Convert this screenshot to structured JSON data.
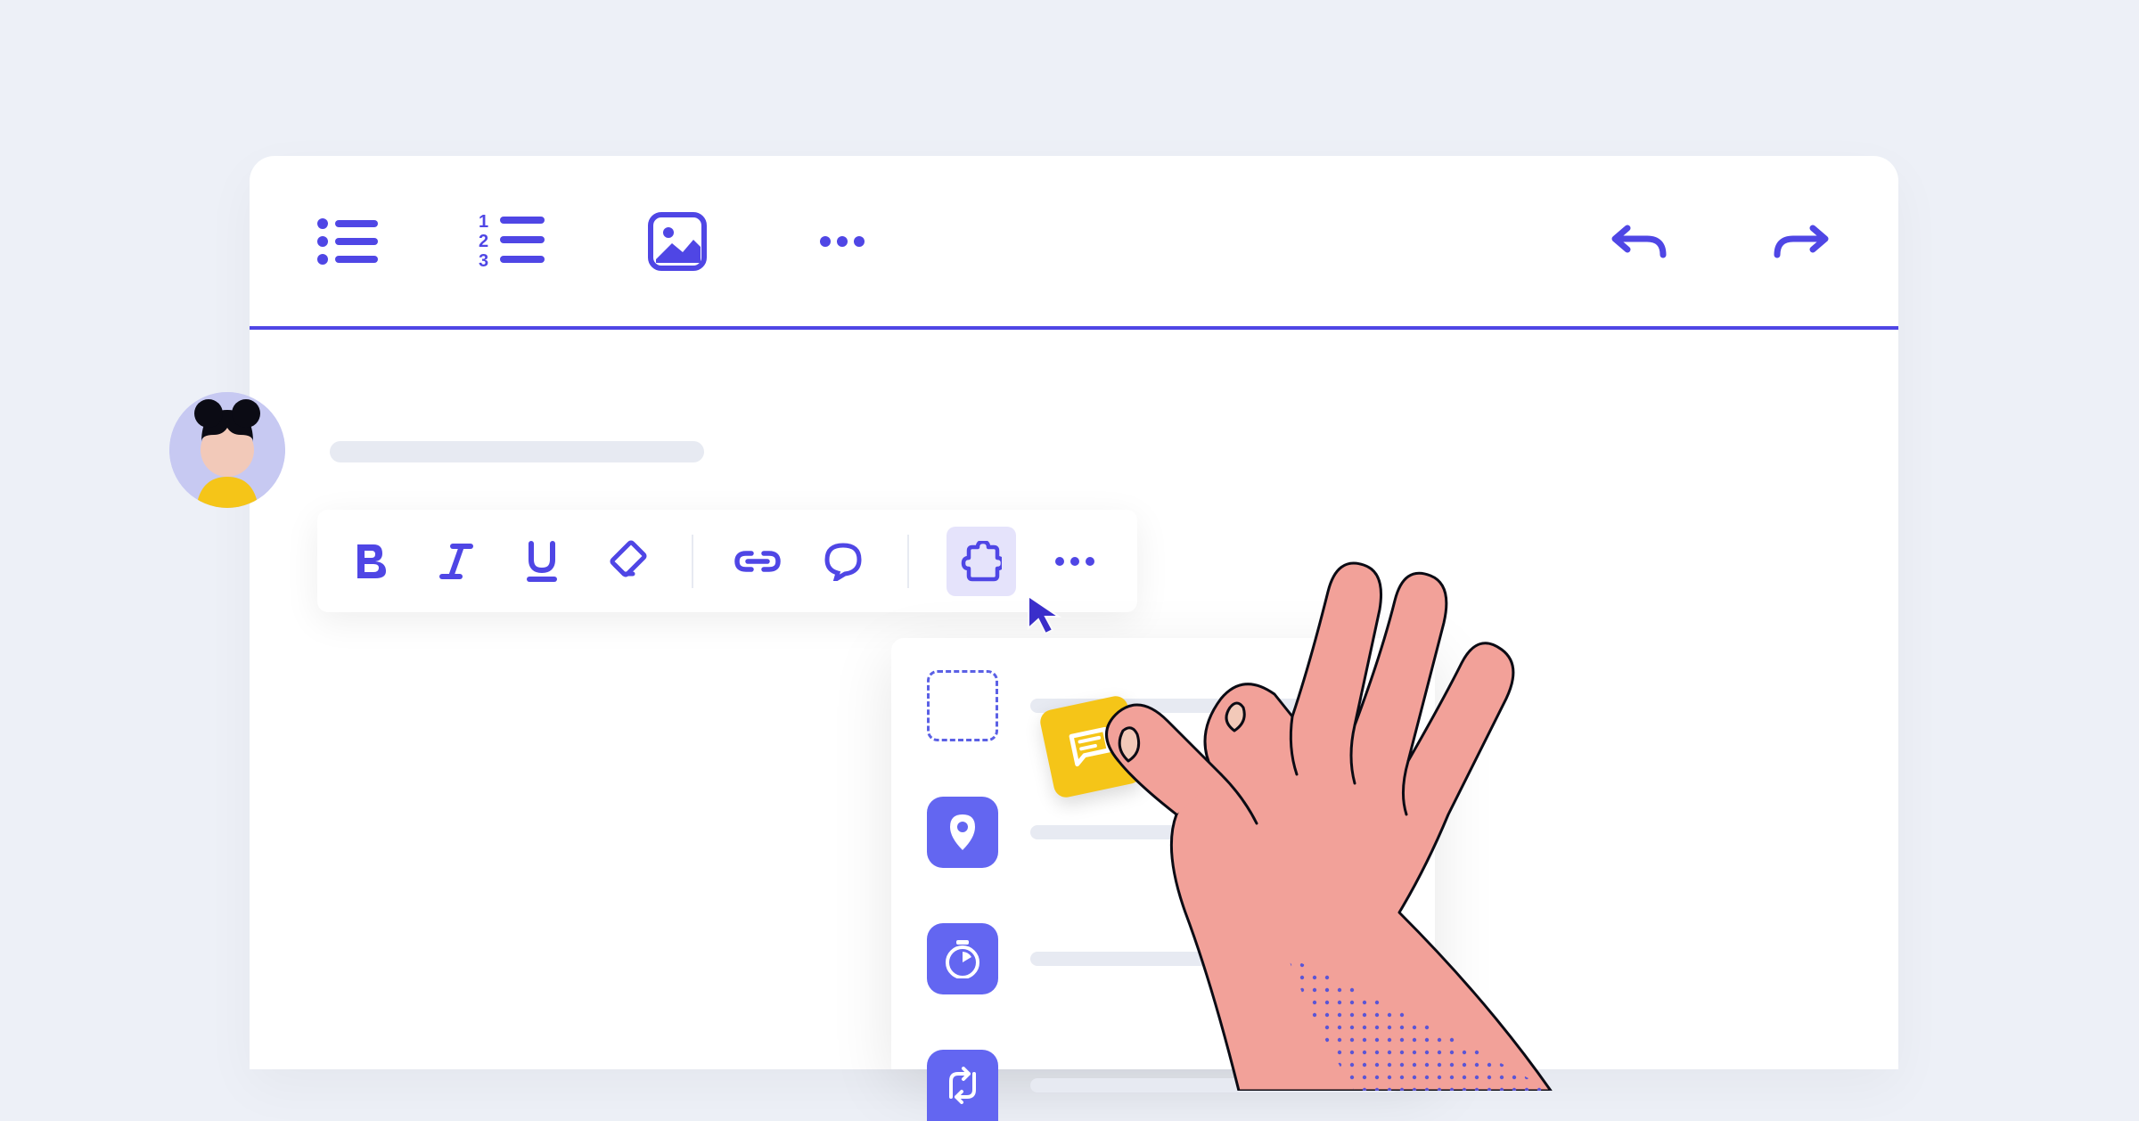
{
  "colors": {
    "accent": "#4F46E5",
    "background": "#EDF0F7",
    "card": "#FFFFFF",
    "placeholder": "#E7EAF2",
    "yellowTile": "#F5C518",
    "hand": "#F2A199"
  },
  "mainToolbar": {
    "left": [
      {
        "name": "bullet-list-icon"
      },
      {
        "name": "numbered-list-icon"
      },
      {
        "name": "image-icon"
      },
      {
        "name": "more-icon"
      }
    ],
    "right": [
      {
        "name": "undo-icon"
      },
      {
        "name": "redo-icon"
      }
    ]
  },
  "floatingToolbar": [
    {
      "name": "bold-icon"
    },
    {
      "name": "italic-icon"
    },
    {
      "name": "underline-icon"
    },
    {
      "name": "clear-format-icon"
    },
    {
      "name": "separator"
    },
    {
      "name": "link-icon"
    },
    {
      "name": "comment-icon"
    },
    {
      "name": "separator"
    },
    {
      "name": "extension-icon",
      "highlighted": true
    },
    {
      "name": "more-icon"
    }
  ],
  "dropdown": {
    "items": [
      {
        "name": "drop-target",
        "style": "dashed"
      },
      {
        "name": "location-pin-icon",
        "style": "solid"
      },
      {
        "name": "stopwatch-icon",
        "style": "solid"
      },
      {
        "name": "route-icon",
        "style": "solid"
      }
    ]
  },
  "draggedTile": {
    "name": "text-block-icon",
    "color": "yellow"
  },
  "avatar": {
    "name": "user-avatar"
  }
}
